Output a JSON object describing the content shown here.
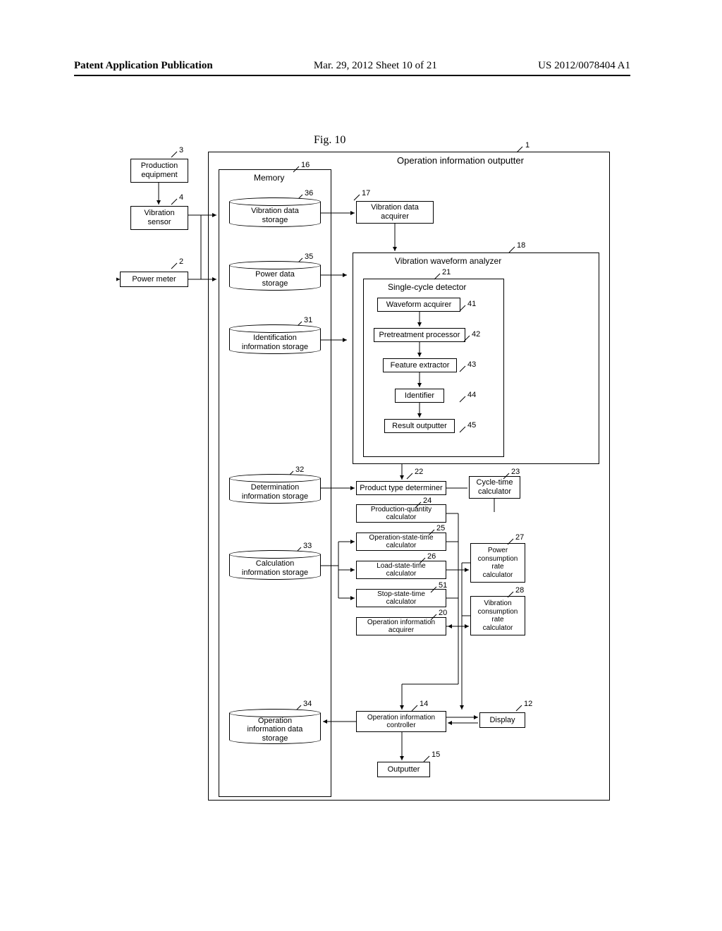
{
  "header": {
    "left": "Patent Application Publication",
    "mid": "Mar. 29, 2012  Sheet 10 of 21",
    "right": "US 2012/0078404 A1"
  },
  "fig_title": "Fig. 10",
  "external": {
    "prod_equip": "Production\nequipment",
    "vib_sensor": "Vibration\nsensor",
    "power_meter": "Power meter"
  },
  "outputter_label": "Operation information outputter",
  "memory_label": "Memory",
  "storage": {
    "vib_data": "Vibration data\nstorage",
    "power_data": "Power data\nstorage",
    "ident_info": "Identification\ninformation storage",
    "det_info": "Determination\ninformation storage",
    "calc_info": "Calculation\ninformation storage",
    "op_info": "Operation\ninformation data\nstorage"
  },
  "right_col": {
    "vib_acq": "Vibration data\nacquirer",
    "analyzer_label": "Vibration waveform analyzer",
    "single_cycle_label": "Single-cycle detector",
    "wave_acq": "Waveform acquirer",
    "pretreat": "Pretreatment processor",
    "feat_ext": "Feature extractor",
    "identifier": "Identifier",
    "result_out": "Result outputter",
    "prod_type": "Product type determiner",
    "cycle_time": "Cycle-time\ncalculator",
    "prod_qty": "Production-quantity\ncalculator",
    "op_state": "Operation-state-time\ncalculator",
    "load_state": "Load-state-time\ncalculator",
    "stop_state": "Stop-state-time\ncalculator",
    "op_acq": "Operation information\nacquirer",
    "power_rate": "Power\nconsumption\nrate\ncalculator",
    "vib_rate": "Vibration\nconsumption\nrate\ncalculator",
    "op_ctrl": "Operation information\ncontroller",
    "display": "Display",
    "outputter": "Outputter"
  },
  "refs": {
    "r1": "1",
    "r2": "2",
    "r3": "3",
    "r4": "4",
    "r12": "12",
    "r14": "14",
    "r15": "15",
    "r16": "16",
    "r17": "17",
    "r18": "18",
    "r20": "20",
    "r21": "21",
    "r22": "22",
    "r23": "23",
    "r24": "24",
    "r25": "25",
    "r26": "26",
    "r27": "27",
    "r28": "28",
    "r31": "31",
    "r32": "32",
    "r33": "33",
    "r34": "34",
    "r35": "35",
    "r36": "36",
    "r41": "41",
    "r42": "42",
    "r43": "43",
    "r44": "44",
    "r45": "45",
    "r51": "51"
  }
}
